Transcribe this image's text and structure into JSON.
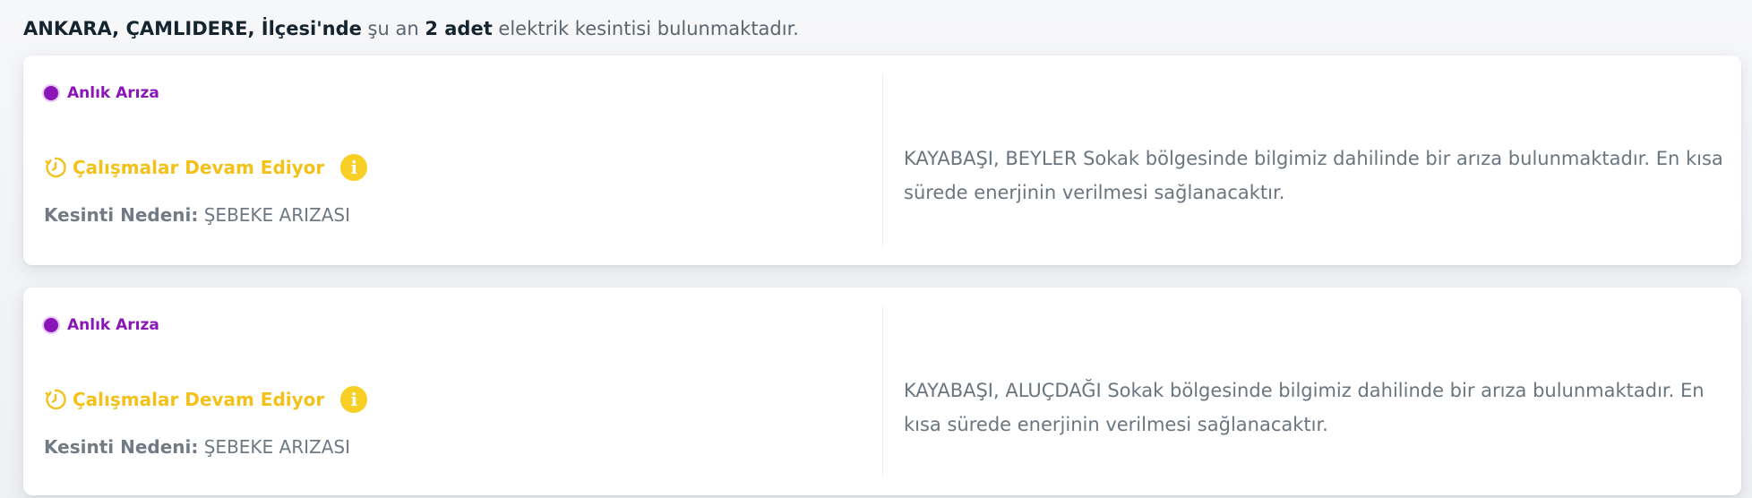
{
  "summary": {
    "location": "ANKARA, ÇAMLIDERE, İlçesi'nde",
    "text_before_count": " şu an ",
    "count": "2 adet",
    "text_after_count": " elektrik kesintisi bulunmaktadır."
  },
  "outages": [
    {
      "type": "Anlık Arıza",
      "status": "Çalışmalar Devam Ediyor",
      "reason_label": "Kesinti Nedeni:",
      "reason_value": "ŞEBEKE ARIZASI",
      "description": "KAYABAŞI, BEYLER Sokak bölgesinde bilgimiz dahilinde bir arıza bulunmaktadır. En kısa sürede enerjinin verilmesi sağlanacaktır."
    },
    {
      "type": "Anlık Arıza",
      "status": "Çalışmalar Devam Ediyor",
      "reason_label": "Kesinti Nedeni:",
      "reason_value": "ŞEBEKE ARIZASI",
      "description": "KAYABAŞI, ALUÇDAĞI Sokak bölgesinde bilgimiz dahilinde bir arıza bulunmaktadır. En kısa sürede enerjinin verilmesi sağlanacaktır."
    }
  ],
  "icons": {
    "info": "i",
    "status": "in-progress-clock-icon"
  },
  "colors": {
    "type_purple": "#8a15b8",
    "status_yellow": "#f3c21a",
    "info_yellow": "#f8cf24"
  }
}
